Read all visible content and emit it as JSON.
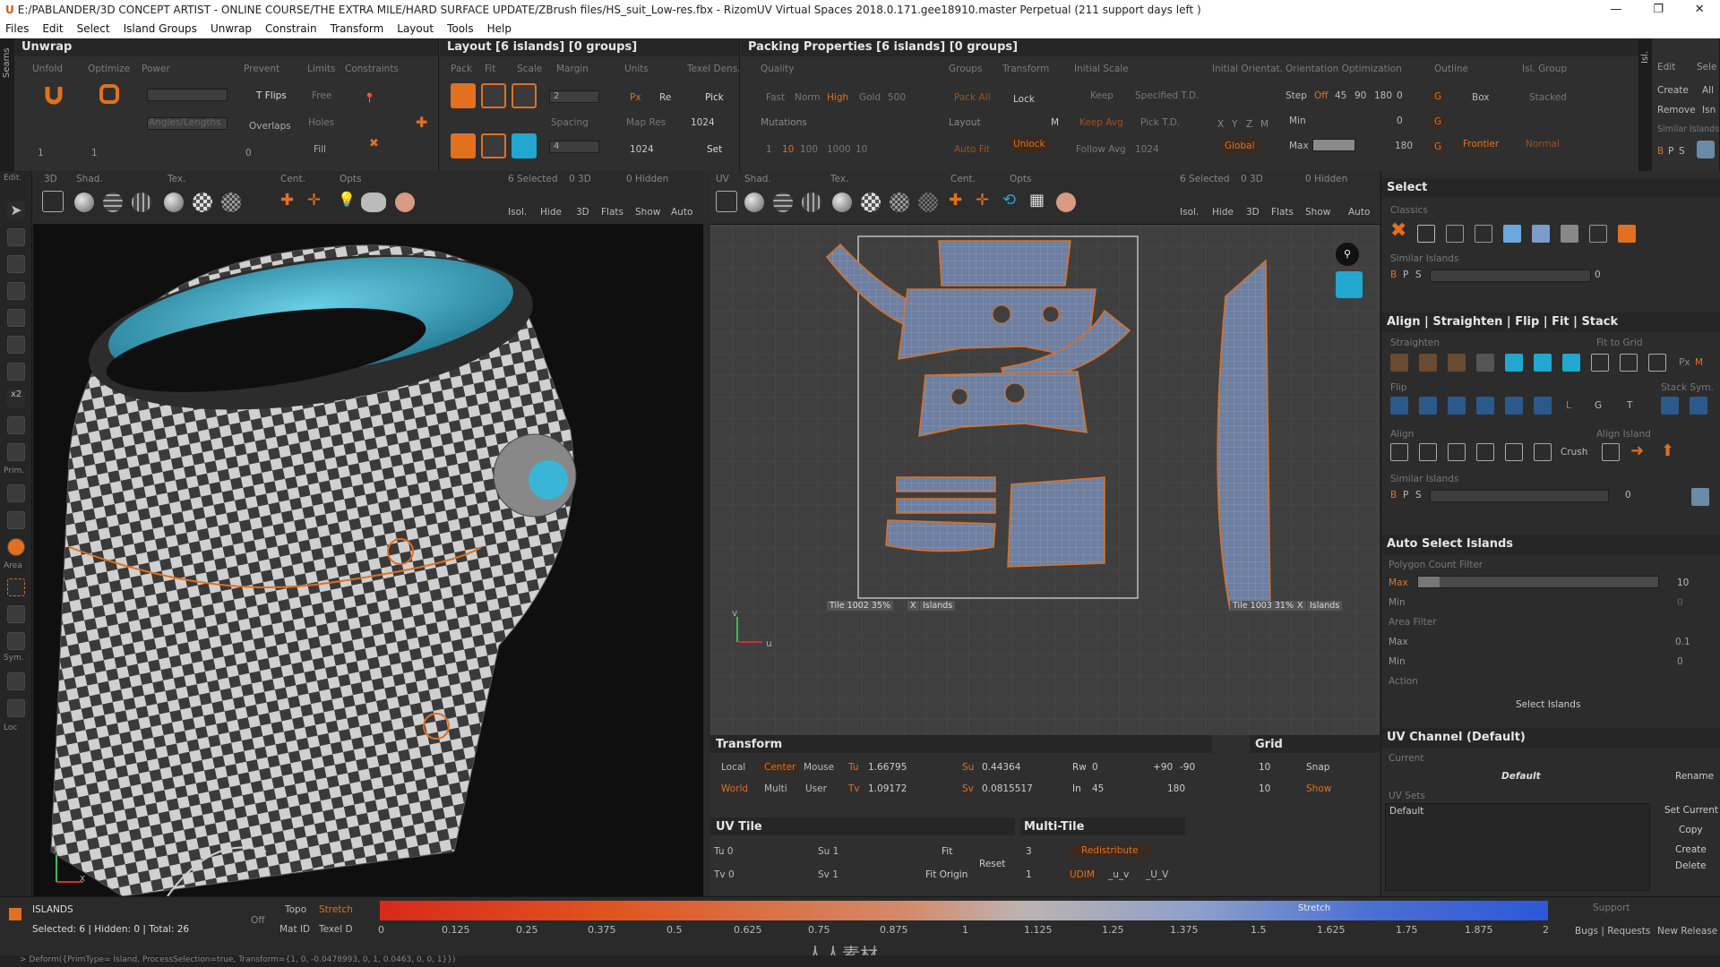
{
  "window": {
    "title": "E:/PABLANDER/3D CONCEPT ARTIST - ONLINE COURSE/THE EXTRA MILE/HARD SURFACE UPDATE/ZBrush files/HS_suit_Low-res.fbx - RizomUV  Virtual Spaces 2018.0.171.gee18910.master Perpetual  (211 support days left )",
    "min": "—",
    "max": "❐",
    "close": "✕"
  },
  "menu": [
    "Files",
    "Edit",
    "Select",
    "Island Groups",
    "Unwrap",
    "Constrain",
    "Transform",
    "Layout",
    "Tools",
    "Help"
  ],
  "seams_tab": "Seams",
  "unwrap": {
    "title": "Unwrap",
    "subs": [
      "Unfold",
      "Optimize",
      "Power",
      "Prevent",
      "Limits",
      "Constraints"
    ],
    "tflips": "T Flips",
    "free": "Free",
    "angles": "Angles/Lengths",
    "overlaps": "Overlaps",
    "holes": "Holes",
    "fill": "Fill",
    "v1": "1",
    "v2": "1",
    "v3": "0"
  },
  "layout": {
    "title": "Layout [6 islands] [0 groups]",
    "subs": [
      "Pack",
      "Fit",
      "Scale",
      "Margin",
      "Units",
      "Texel Dens."
    ],
    "margin": "2",
    "spacing_label": "Spacing",
    "spacing": "4",
    "units_px": "Px",
    "re": "Re",
    "map_res": "Map Res",
    "res1": "1024",
    "res2": "1024",
    "pick": "Pick",
    "set": "Set"
  },
  "packing": {
    "title": "Packing Properties [6 islands] [0 groups]",
    "subs": [
      "Quality",
      "Groups",
      "Transform",
      "Initial Scale",
      "Initial Orientat.",
      "Orientation Optimization",
      "Outline",
      "Isl. Group"
    ],
    "quality": [
      "Fast",
      "Norm",
      "High",
      "Gold",
      "500"
    ],
    "mutations": "Mutations",
    "mut_vals": [
      "1",
      "10",
      "100",
      "1000",
      "10"
    ],
    "pack_all": "Pack All",
    "layout": "Layout",
    "auto_fit": "Auto Fit",
    "lock": "Lock",
    "unlock": "Unlock",
    "m": "M",
    "keep": "Keep",
    "keep_avg": "Keep Avg",
    "follow_avg": "Follow Avg",
    "follow_val": "1024",
    "specified": "Specified T.D.",
    "pick_td": "Pick T.D.",
    "xyzm": [
      "X",
      "Y",
      "Z",
      "M"
    ],
    "global": "Global",
    "step": "Step",
    "off": "Off",
    "angles": [
      "45",
      "90",
      "180",
      "0"
    ],
    "min": "Min",
    "min_val": "0",
    "max": "Max",
    "max_val": "180",
    "g": "G",
    "box": "Box",
    "frontier": "Frontier",
    "stacked": "Stacked",
    "normal": "Normal"
  },
  "islands_panel": {
    "tab": "Isl.",
    "edit": "Edit",
    "sele": "Sele",
    "create": "Create",
    "all": "All",
    "remove": "Remove",
    "isn": "Isn",
    "similar": "Similar Islands",
    "bps": [
      "B",
      "P",
      "S"
    ]
  },
  "lefttools": {
    "edit": "Edit.",
    "prim": "Prim.",
    "area": "Area",
    "sym": "Sym.",
    "loc": "Loc"
  },
  "view3d": {
    "labels": [
      "3D",
      "Shad.",
      "Tex.",
      "Cent.",
      "Opts"
    ],
    "selected": "6 Selected",
    "d3": "0 3D",
    "hidden": "0 Hidden",
    "buttons": [
      "Isol.",
      "Hide",
      "3D",
      "Flats",
      "Show",
      "Auto"
    ],
    "axis_y": "y",
    "axis_x": "x"
  },
  "viewuv": {
    "labels": [
      "UV",
      "Shad.",
      "Tex.",
      "Cent.",
      "Opts"
    ],
    "selected": "6 Selected",
    "d3": "0 3D",
    "hidden": "0 Hidden",
    "buttons": [
      "Isol.",
      "Hide",
      "3D",
      "Flats",
      "Show",
      "Auto"
    ],
    "tile1": "Tile 1002 35%",
    "tile2": "Tile 1003 31%",
    "x": "X",
    "islands": "Islands",
    "axis_v": "v",
    "axis_u": "u"
  },
  "transform": {
    "title": "Transform",
    "local": "Local",
    "center": "Center",
    "mouse": "Mouse",
    "world": "World",
    "multi": "Multi",
    "user": "User",
    "tu": "Tu",
    "tu_val": "1.66795",
    "tv": "Tv",
    "tv_val": "1.09172",
    "su": "Su",
    "su_val": "0.44364",
    "sv": "Sv",
    "sv_val": "0.0815517",
    "rw": "Rw",
    "rw_val": "0",
    "in": "In",
    "in_val": "45",
    "p90": "+90",
    "m90": "-90",
    "r180": "180"
  },
  "grid": {
    "title": "Grid",
    "v1": "10",
    "v2": "10",
    "snap": "Snap",
    "show": "Show"
  },
  "uvtile": {
    "title": "UV Tile",
    "tu": "Tu 0",
    "tv": "Tv 0",
    "su": "Su 1",
    "sv": "Sv 1",
    "fit": "Fit",
    "reset": "Reset",
    "fit_origin": "Fit Origin"
  },
  "multitile": {
    "title": "Multi-Tile",
    "v1": "3",
    "v2": "1",
    "redistribute": "Redistribute",
    "udim": "UDIM",
    "uv1": "_u_v",
    "uv2": "_U_V"
  },
  "select": {
    "title": "Select",
    "classics": "Classics",
    "similar": "Similar Islands",
    "bps": [
      "B",
      "P",
      "S"
    ],
    "val": "0"
  },
  "align": {
    "title": "Align | Straighten | Flip | Fit | Stack",
    "straighten": "Straighten",
    "fit_grid": "Fit to Grid",
    "flip": "Flip",
    "stack_sym": "Stack Sym.",
    "align": "Align",
    "align_island": "Align Island",
    "crush": "Crush",
    "similar": "Similar Islands",
    "px": "Px",
    "m": "M",
    "l": "L",
    "g": "G",
    "t": "T",
    "bps": [
      "B",
      "P",
      "S"
    ],
    "val": "0"
  },
  "autoselect": {
    "title": "Auto Select Islands",
    "poly_filter": "Polygon Count Filter",
    "max": "Max",
    "max_val": "10",
    "min": "Min",
    "min_val": "0",
    "area_filter": "Area Filter",
    "amax": "Max",
    "amax_val": "0.1",
    "amin": "Min",
    "amin_val": "0",
    "action": "Action",
    "select_islands": "Select Islands"
  },
  "uvchannel": {
    "title": "UV Channel (Default)",
    "current": "Current",
    "default_name": "Default",
    "rename": "Rename",
    "uvsets": "UV Sets",
    "set_item": "Default",
    "set_current": "Set Current",
    "copy": "Copy",
    "create": "Create",
    "delete": "Delete"
  },
  "bottom": {
    "islands": "ISLANDS",
    "selected": "Selected: 6 | Hidden: 0 | Total: 26",
    "off": "Off",
    "topo": "Topo",
    "stretch": "Stretch",
    "matid": "Mat ID",
    "texeld": "Texel D",
    "grad_label": "Stretch",
    "ticks": [
      "0",
      "0.125",
      "0.25",
      "0.375",
      "0.5",
      "0.625",
      "0.75",
      "0.875",
      "1",
      "1.125",
      "1.25",
      "1.375",
      "1.5",
      "1.625",
      "1.75",
      "1.875",
      "2"
    ],
    "support": "Support",
    "bugs": "Bugs | Requests",
    "new_release": "New Release",
    "watermark": "人人素材"
  },
  "status": "> Deform({PrimType= Island, ProcessSelection=true, Transform={1, 0, -0.0478993, 0, 1, 0.0463, 0, 0, 1}})",
  "colors": {
    "accent": "#e2701e",
    "panel": "#2e2e2e",
    "uvbg": "#3f3f3f",
    "cyan": "#22a7d0"
  }
}
